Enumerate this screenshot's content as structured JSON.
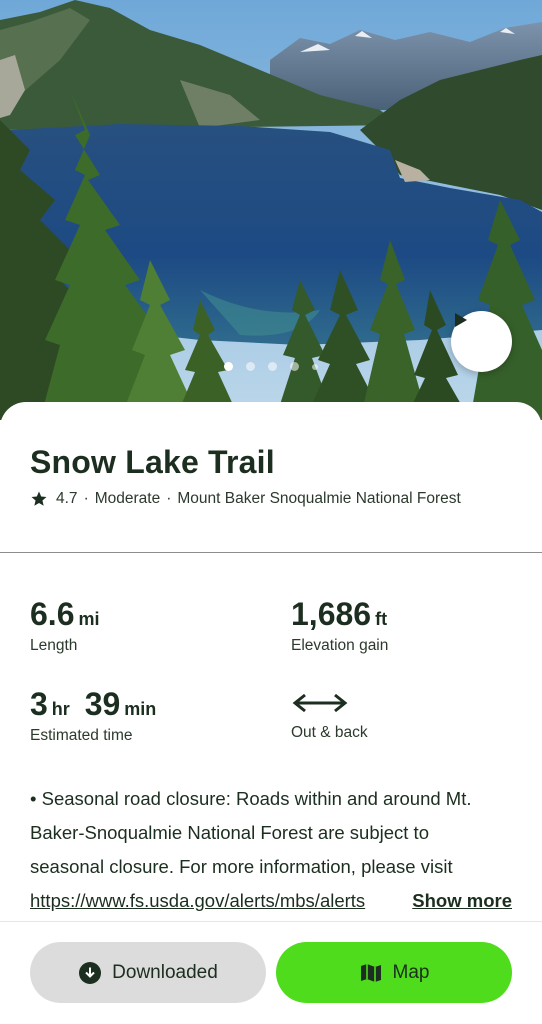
{
  "hero": {
    "play_icon": "play-icon",
    "carousel": {
      "count": 5,
      "active_index": 0
    }
  },
  "trail": {
    "name": "Snow Lake Trail",
    "rating": "4.7",
    "difficulty": "Moderate",
    "location": "Mount Baker Snoqualmie National Forest",
    "separator": "·"
  },
  "stats": {
    "length": {
      "value": "6.6",
      "unit": "mi",
      "label": "Length"
    },
    "elevation": {
      "value": "1,686",
      "unit": "ft",
      "label": "Elevation gain"
    },
    "time": {
      "hours": "3",
      "hours_unit": "hr",
      "minutes": "39",
      "minutes_unit": "min",
      "label": "Estimated time"
    },
    "route": {
      "icon": "double-arrow-icon",
      "label": "Out & back"
    }
  },
  "notes": {
    "line1": "• Seasonal road closure: Roads within and around Mt.",
    "line2": "Baker-Snoqualmie National Forest are subject to",
    "line3": "seasonal closure. For more information, please visit",
    "url": "https://www.fs.usda.gov/alerts/mbs/alerts",
    "show_more": "Show more"
  },
  "actions": {
    "downloaded_label": "Downloaded",
    "map_label": "Map"
  },
  "colors": {
    "primary_green": "#4fdc1c",
    "text_dark": "#1c2e1f",
    "button_gray": "#dcdcdc"
  }
}
